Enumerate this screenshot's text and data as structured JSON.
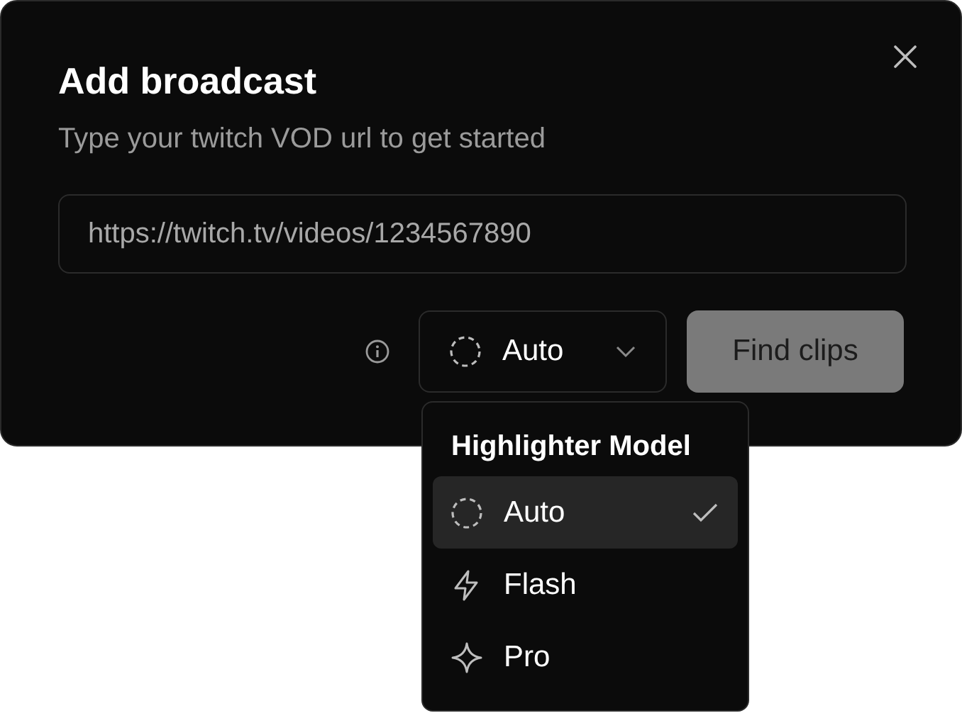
{
  "dialog": {
    "title": "Add broadcast",
    "subtitle": "Type your twitch VOD url to get started"
  },
  "url_field": {
    "value": "https://twitch.tv/videos/1234567890"
  },
  "model_select": {
    "value": "Auto",
    "expanded": true
  },
  "find_button": {
    "label": "Find clips",
    "disabled": true
  },
  "menu": {
    "heading": "Highlighter Model",
    "options": [
      {
        "label": "Auto",
        "kind": "auto",
        "selected": true
      },
      {
        "label": "Flash",
        "kind": "fast",
        "selected": false
      },
      {
        "label": "Pro",
        "kind": "best",
        "selected": false
      }
    ]
  }
}
